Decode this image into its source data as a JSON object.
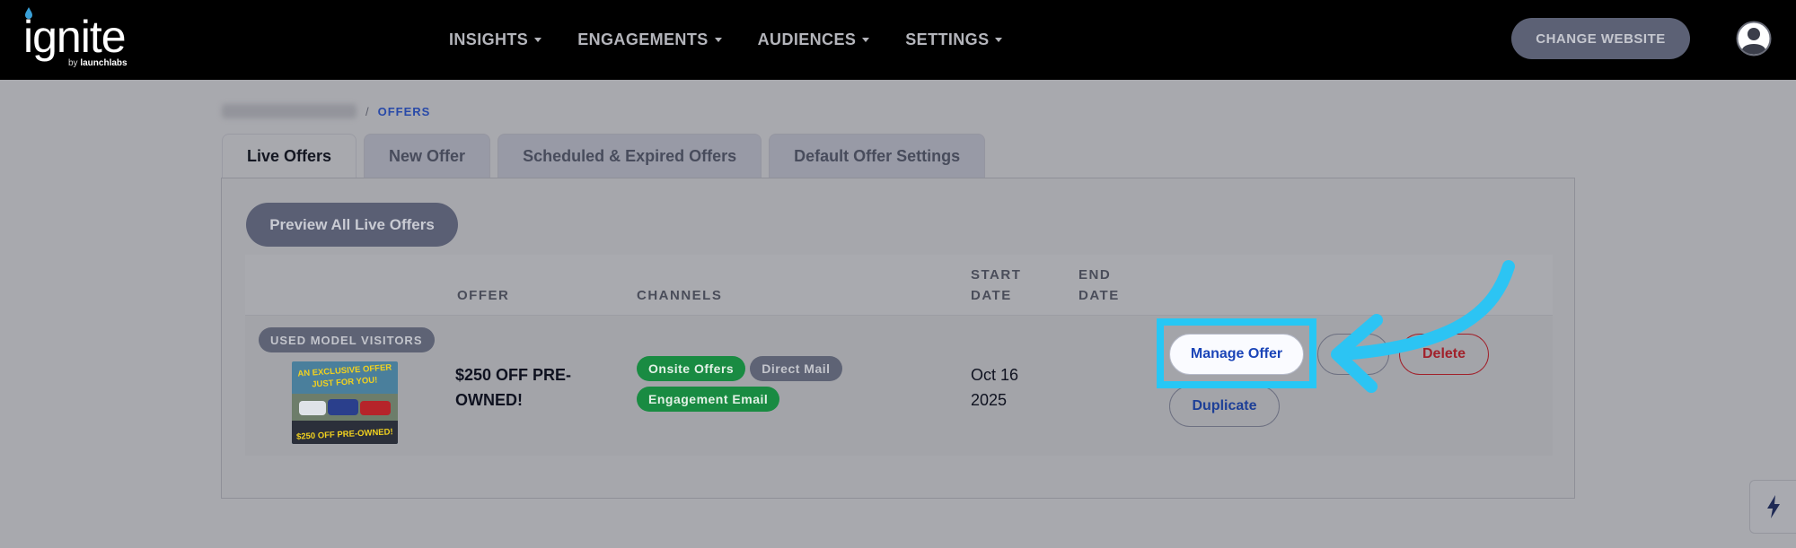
{
  "header": {
    "logo_word": "ignite",
    "logo_by": "by ",
    "logo_brand": "launchlabs",
    "nav": [
      {
        "label": "INSIGHTS"
      },
      {
        "label": "ENGAGEMENTS"
      },
      {
        "label": "AUDIENCES"
      },
      {
        "label": "SETTINGS"
      }
    ],
    "change_website_label": "CHANGE WEBSITE",
    "user_icon": "user-circle-icon"
  },
  "breadcrumb": {
    "current": "OFFERS",
    "separator": "/"
  },
  "tabs": [
    {
      "label": "Live Offers",
      "active": true
    },
    {
      "label": "New Offer",
      "active": false
    },
    {
      "label": "Scheduled & Expired Offers",
      "active": false
    },
    {
      "label": "Default Offer Settings",
      "active": false
    }
  ],
  "panel": {
    "preview_label": "Preview All Live Offers",
    "columns": {
      "offer": "OFFER",
      "channels": "CHANNELS",
      "start_date_1": "START",
      "start_date_2": "DATE",
      "end_date_1": "END",
      "end_date_2": "DATE"
    },
    "rows": [
      {
        "segment": "USED MODEL VISITORS",
        "thumb_lines": [
          "AN EXCLUSIVE OFFER",
          "JUST FOR YOU!",
          "$250 OFF PRE-OWNED!"
        ],
        "offer": "$250 OFF PRE-OWNED!",
        "channels": [
          {
            "label": "Onsite Offers",
            "kind": "green"
          },
          {
            "label": "Direct Mail",
            "kind": "gray"
          },
          {
            "label": "Engagement Email",
            "kind": "green"
          }
        ],
        "start_date": "Oct 16 2025",
        "end_date": "",
        "actions": {
          "manage": "Manage Offer",
          "delete": "Delete",
          "duplicate": "Duplicate"
        }
      }
    ]
  },
  "colors": {
    "header_bg": "#000000",
    "highlight": "#26c7f5",
    "channel_green": "#198b42",
    "link_blue": "#1b45b8",
    "delete_red": "#a1212b"
  }
}
